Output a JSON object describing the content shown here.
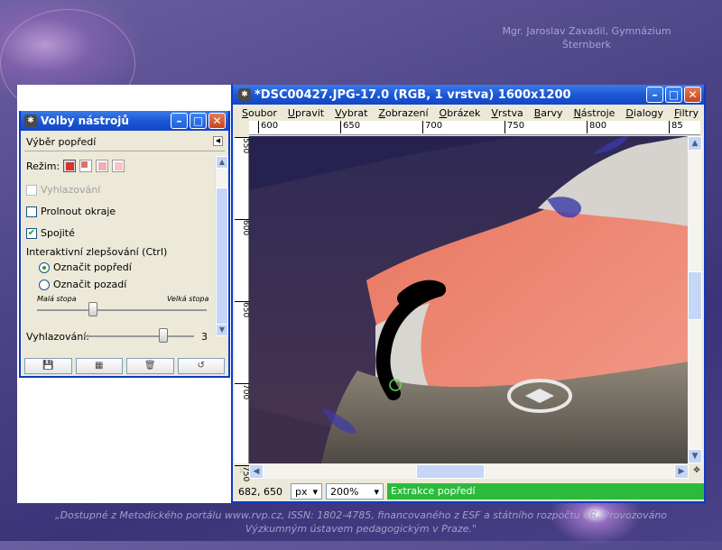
{
  "slide": {
    "author_line1": "Mgr. Jaroslav Zavadil, Gymnázium",
    "author_line2": "Šternberk",
    "footer_line1": "„Dostupné z Metodického portálu www.rvp.cz, ISSN: 1802-4785, financovaného z ESF a státního rozpočtu ČR. Provozováno",
    "footer_line2": "Výzkumným ústavem pedagogickým v Praze.\""
  },
  "tool_window": {
    "title": "Volby nástrojů",
    "section_title": "Výběr popředí",
    "mode_label": "Režim:",
    "antialias_label": "Vyhlazování",
    "feather_label": "Prolnout okraje",
    "contiguous_label": "Spojité",
    "refine_label": "Interaktivní zlepšování (Ctrl)",
    "mark_fg_label": "Označit popředí",
    "mark_bg_label": "Označit pozadí",
    "small_stroke": "Malá stopa",
    "large_stroke": "Velká stopa",
    "smoothing_label": "Vyhlazování:",
    "smoothing_value": "3",
    "stroke_fraction": 0.33,
    "smoothing_fraction": 0.72
  },
  "image_window": {
    "title": "*DSC00427.JPG-17.0 (RGB, 1 vrstva) 1600x1200",
    "menu": [
      "Soubor",
      "Upravit",
      "Vybrat",
      "Zobrazení",
      "Obrázek",
      "Vrstva",
      "Barvy",
      "Nástroje",
      "Dialogy",
      "Filtry"
    ],
    "ruler_ticks": [
      "600",
      "650",
      "700",
      "750",
      "800",
      "85"
    ],
    "vruler_ticks": [
      "550",
      "600",
      "650",
      "700",
      "750"
    ],
    "coords": "682, 650",
    "unit": "px",
    "zoom": "200%",
    "status_message": "Extrakce popředí"
  }
}
